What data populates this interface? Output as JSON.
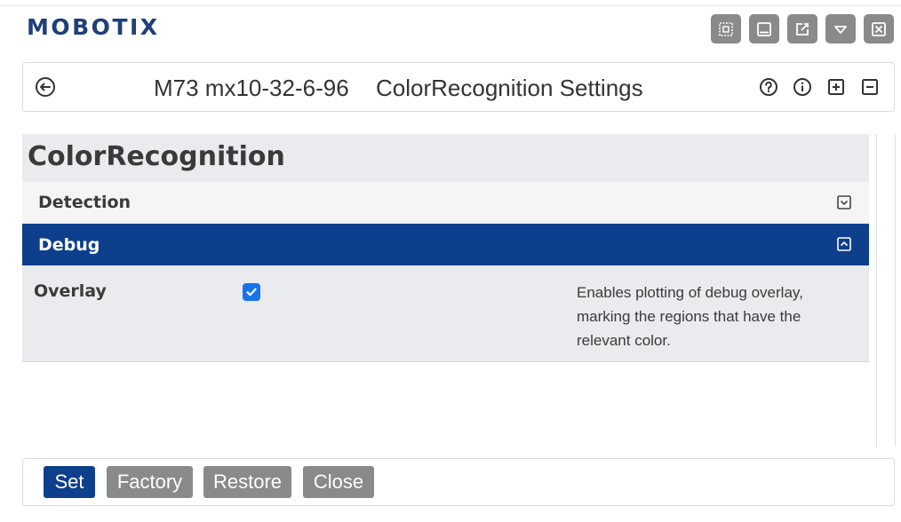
{
  "brand": {
    "logo_text": "MOBOTIX",
    "color": "#1d3f7a"
  },
  "window_controls": [
    {
      "name": "fit-icon"
    },
    {
      "name": "minimize-icon"
    },
    {
      "name": "popout-icon"
    },
    {
      "name": "dropdown-icon"
    },
    {
      "name": "close-icon"
    }
  ],
  "titlebar": {
    "back_icon": "back-arrow-icon",
    "device": "M73 mx10-32-6-96",
    "page": "ColorRecognition Settings",
    "icons": [
      "help-icon",
      "info-icon",
      "expand-all-icon",
      "collapse-all-icon"
    ]
  },
  "panel": {
    "title": "ColorRecognition",
    "sections": [
      {
        "label": "Detection",
        "expanded": false
      },
      {
        "label": "Debug",
        "expanded": true
      }
    ],
    "fields": [
      {
        "label": "Overlay",
        "checked": true,
        "description": "Enables plotting of debug overlay, marking the regions that have the relevant color."
      }
    ]
  },
  "footer": {
    "set_label": "Set",
    "factory_label": "Factory",
    "restore_label": "Restore",
    "close_label": "Close"
  },
  "colors": {
    "accent": "#0e3f8c",
    "button_gray": "#8a8a8a",
    "checkbox": "#1a73e8",
    "panel_bg": "#e9ebee"
  }
}
